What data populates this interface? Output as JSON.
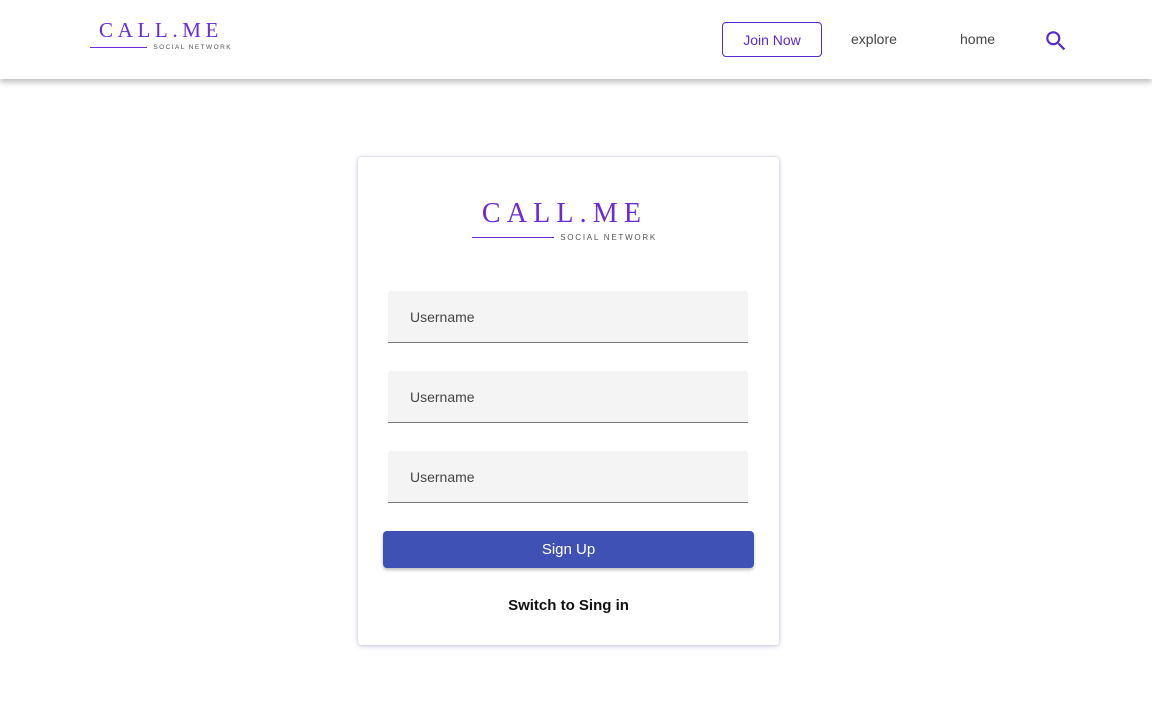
{
  "brand": {
    "name": "CALL.ME",
    "tagline": "SOCIAL NETWORK",
    "color": "#6a2bd9"
  },
  "nav": {
    "join_label": "Join Now",
    "explore_label": "explore",
    "home_label": "home",
    "search_icon": "search-icon",
    "accent": "#5a2ad0"
  },
  "form": {
    "fields": [
      {
        "placeholder": "Username",
        "value": ""
      },
      {
        "placeholder": "Username",
        "value": ""
      },
      {
        "placeholder": "Username",
        "value": ""
      }
    ],
    "submit_label": "Sign Up",
    "submit_color": "#3f51b5",
    "switch_label": "Switch to Sing in"
  }
}
